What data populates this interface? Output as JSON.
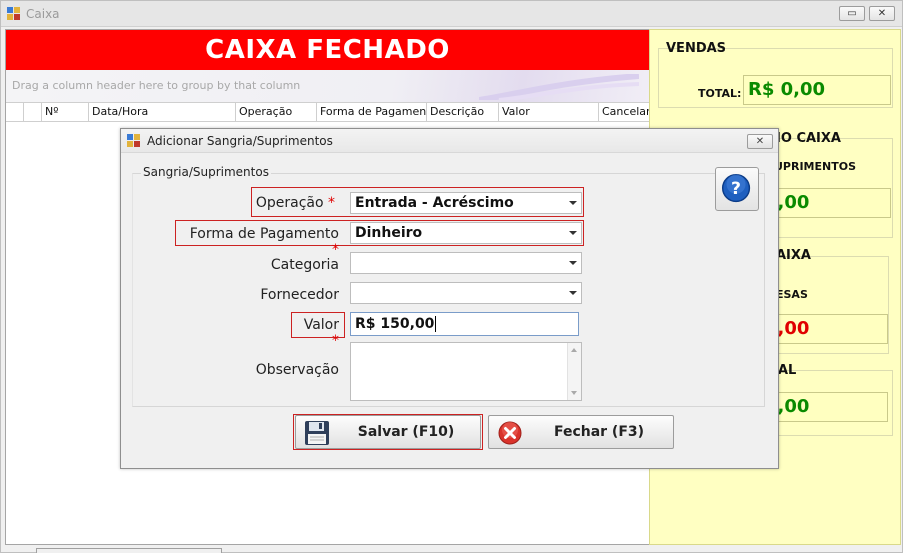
{
  "window": {
    "title": "Caixa",
    "controls": {
      "maximize": "▭",
      "close": "✕"
    }
  },
  "grid": {
    "banner": "CAIXA FECHADO",
    "group_hint": "Drag a column header here to group by that column",
    "columns": [
      "Nº",
      "Data/Hora",
      "Operação",
      "Forma de Pagamento",
      "Descrição",
      "Valor",
      "Cancelar"
    ]
  },
  "summary": {
    "vendas": {
      "title": "VENDAS",
      "label": "TOTAL:",
      "value": "R$ 0,00"
    },
    "no_caixa": {
      "title": "NO CAIXA",
      "label": "UPRIMENTOS",
      "value": "0,00"
    },
    "caixa": {
      "title": "AIXA",
      "label": "ESAS",
      "value": "0,00"
    },
    "total": {
      "title": "AL",
      "value": "0,00"
    }
  },
  "dialog": {
    "title": "Adicionar Sangria/Suprimentos",
    "close": "✕",
    "group_title": "Sangria/Suprimentos",
    "fields": {
      "operacao": {
        "label": "Operação",
        "required": "*",
        "value": "Entrada - Acréscimo"
      },
      "forma": {
        "label": "Forma de Pagamento",
        "required": "*",
        "value": "Dinheiro"
      },
      "categoria": {
        "label": "Categoria",
        "value": ""
      },
      "fornecedor": {
        "label": "Fornecedor",
        "value": ""
      },
      "valor": {
        "label": "Valor",
        "required": "*",
        "value": "R$ 150,00"
      },
      "observacao": {
        "label": "Observação",
        "value": ""
      }
    },
    "buttons": {
      "save": "Salvar (F10)",
      "close": "Fechar (F3)"
    }
  },
  "colors": {
    "banner": "#ff0000",
    "panel": "#ffffc2",
    "positive": "#0a8a00",
    "negative": "#e00000",
    "required": "#e00000"
  }
}
